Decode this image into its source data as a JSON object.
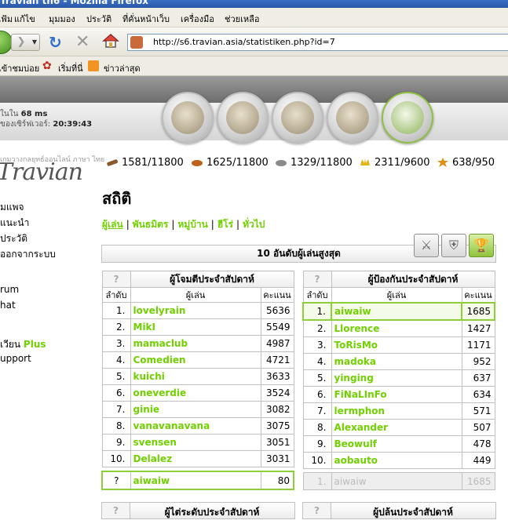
{
  "window": {
    "title": "Travian th6 - Mozilla Firefox"
  },
  "menu": [
    "แฟ้ม",
    "แก้ไข",
    "มุมมอง",
    "ประวัติ",
    "ที่คั่นหน้าเว็บ",
    "เครื่องมือ",
    "ช่วยเหลือ"
  ],
  "browser": {
    "url": "http://s6.travian.asia/statistiken.php?id=7"
  },
  "bookmarks": [
    "เข้าชมบ่อย",
    "เริ่มที่นี่",
    "ข่าวล่าสุด"
  ],
  "server": {
    "ping_label": "ในใน",
    "ping_value": "68 ms",
    "time_label": "ของเซิร์ฟเวอร์:",
    "time_value": "20:39:43"
  },
  "logo": {
    "text": "Travian",
    "sub": "เกมวางกลยุทธ์ออนไลน์ ภาษา ไทย"
  },
  "left_menu": [
    "มแพจ",
    "แนะนำ",
    "ประวัติ",
    "ออกจากระบบ",
    "rum",
    "hat",
    "เวียน",
    "Plus",
    "upport"
  ],
  "resources": {
    "wood": "1581/11800",
    "clay": "1625/11800",
    "iron": "1329/11800",
    "crop": "2311/9600",
    "consumption": "638/950"
  },
  "page": {
    "title": "สถิติ",
    "tabs": [
      "ผู้เล่น",
      "พันธมิตร",
      "หมู่บ้าน",
      "ฮีโร่",
      "ทั่วไป"
    ],
    "section_title": "10 อันดับผู้เล่นสูงสุด"
  },
  "attackers": {
    "q": "?",
    "title": "ผู้โจมตีประจำสัปดาห์",
    "col_rank": "ลำดับ",
    "col_player": "ผู้เล่น",
    "col_points": "คะแนน",
    "rows": [
      {
        "rank": "1.",
        "player": "lovelyrain",
        "points": "5636"
      },
      {
        "rank": "2.",
        "player": "MikI",
        "points": "5549"
      },
      {
        "rank": "3.",
        "player": "mamaclub",
        "points": "4987"
      },
      {
        "rank": "4.",
        "player": "Comedien",
        "points": "4721"
      },
      {
        "rank": "5.",
        "player": "kuichi",
        "points": "3633"
      },
      {
        "rank": "6.",
        "player": "oneverdie",
        "points": "3524"
      },
      {
        "rank": "7.",
        "player": "ginie",
        "points": "3082"
      },
      {
        "rank": "8.",
        "player": "vanavanavana",
        "points": "3075"
      },
      {
        "rank": "9.",
        "player": "svensen",
        "points": "3051"
      },
      {
        "rank": "10.",
        "player": "Delalez",
        "points": "3031"
      }
    ],
    "own": {
      "rank": "?",
      "player": "aiwaiw",
      "points": "80"
    }
  },
  "defenders": {
    "q": "?",
    "title": "ผู้ป้องกันประจำสัปดาห์",
    "col_rank": "ลำดับ",
    "col_player": "ผู้เล่น",
    "col_points": "คะแนน",
    "rows": [
      {
        "rank": "1.",
        "player": "aiwaiw",
        "points": "1685"
      },
      {
        "rank": "2.",
        "player": "Llorence",
        "points": "1427"
      },
      {
        "rank": "3.",
        "player": "ToRisMo",
        "points": "1171"
      },
      {
        "rank": "4.",
        "player": "madoka",
        "points": "952"
      },
      {
        "rank": "5.",
        "player": "yinging",
        "points": "637"
      },
      {
        "rank": "6.",
        "player": "FiNaLInFo",
        "points": "634"
      },
      {
        "rank": "7.",
        "player": "lermphon",
        "points": "571"
      },
      {
        "rank": "8.",
        "player": "Alexander",
        "points": "507"
      },
      {
        "rank": "9.",
        "player": "Beowulf",
        "points": "478"
      },
      {
        "rank": "10.",
        "player": "aobauto",
        "points": "449"
      }
    ],
    "own": {
      "rank": "1.",
      "player": "aiwaiw",
      "points": "1685"
    }
  },
  "bottom_tables": {
    "left_q": "?",
    "left_title": "ผู้ไต่ระดับประจำสัปดาห์",
    "right_q": "?",
    "right_title": "ผู้ปล้นประจำสัปดาห์"
  },
  "colors": {
    "accent": "#71d000",
    "highlight_border": "#8bd039"
  }
}
